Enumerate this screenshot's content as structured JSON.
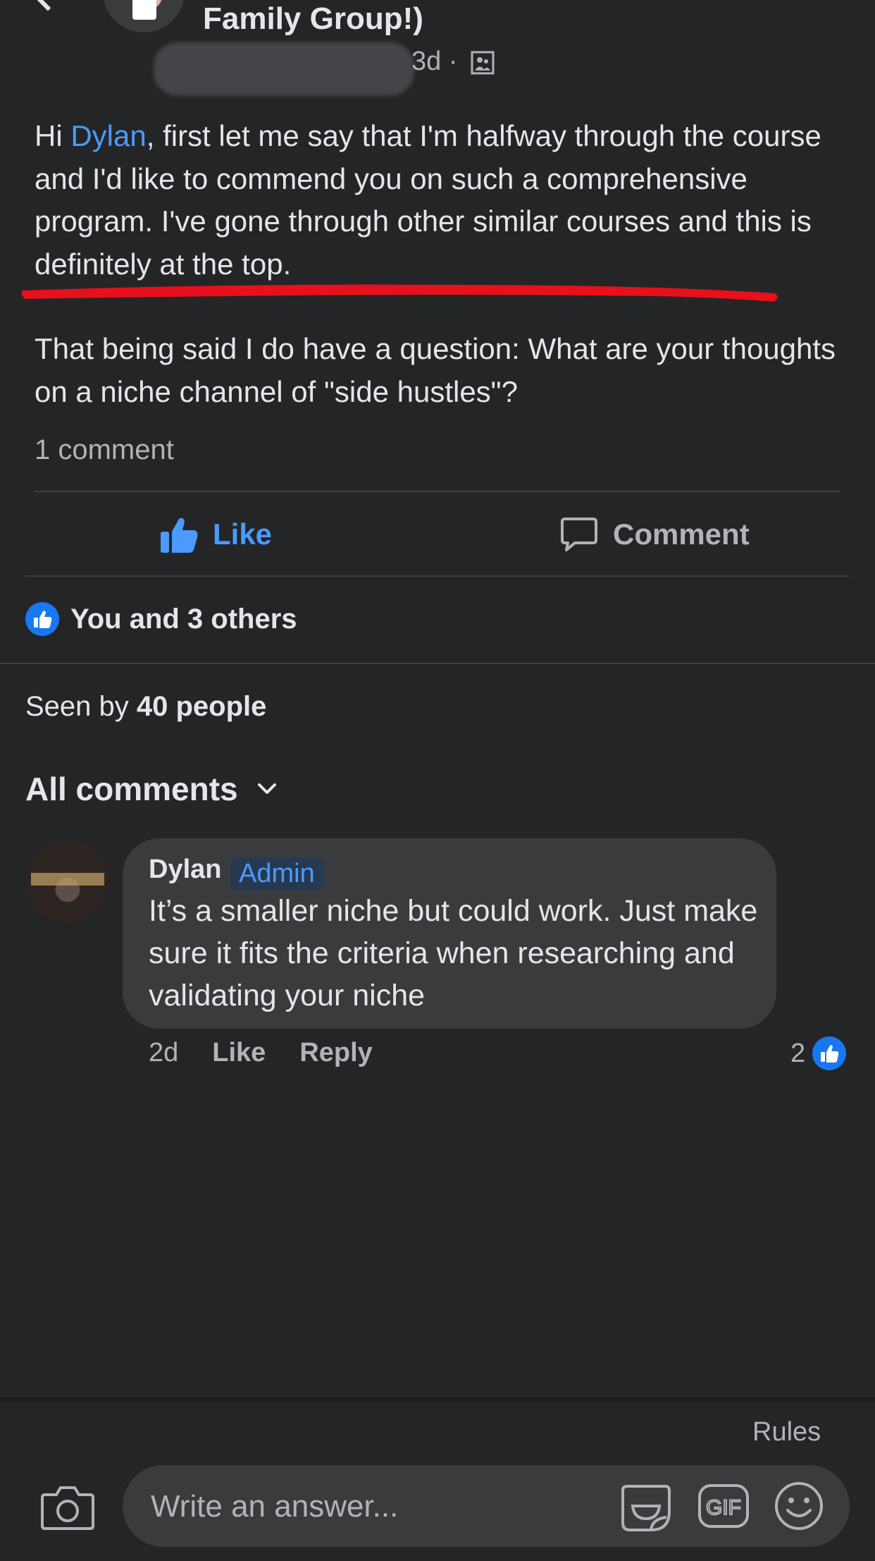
{
  "post": {
    "title": "Family Group!)",
    "time": "3d ·",
    "mention": "Dylan",
    "body_prefix": "Hi ",
    "body_rest": ", first let me say that I'm halfway through the course and I'd like to commend you on such a comprehensive program.  I've gone through other similar courses and this is definitely at the top.",
    "body_para2": "That being said I do have a question:  What are your thoughts on a niche channel of \"side hustles\"?",
    "comment_count": "1 comment"
  },
  "actions": {
    "like_label": "Like",
    "comment_label": "Comment"
  },
  "reactions": {
    "summary": "You and 3 others"
  },
  "seen": {
    "prefix": "Seen by ",
    "count": "40 people"
  },
  "comments_header": {
    "label": "All comments"
  },
  "comment": {
    "author": "Dylan",
    "badge": "Admin",
    "text": "It’s a smaller niche but could work. Just make sure it fits the criteria when researching and validating your niche",
    "age": "2d",
    "like_label": "Like",
    "reply_label": "Reply",
    "reaction_count": "2"
  },
  "composer": {
    "rules_label": "Rules",
    "placeholder": "Write an answer...",
    "gif_label": "GIF"
  },
  "colors": {
    "background": "#242526",
    "accent": "#4a9aff",
    "like_blue": "#1877f2",
    "highlight_red": "#e8101c"
  },
  "icons": [
    "back-chevron-icon",
    "privacy-members-icon",
    "thumbs-up-icon",
    "comment-bubble-icon",
    "like-reaction-icon",
    "chevron-down-icon",
    "camera-icon",
    "sticker-icon",
    "gif-icon",
    "emoji-icon"
  ]
}
